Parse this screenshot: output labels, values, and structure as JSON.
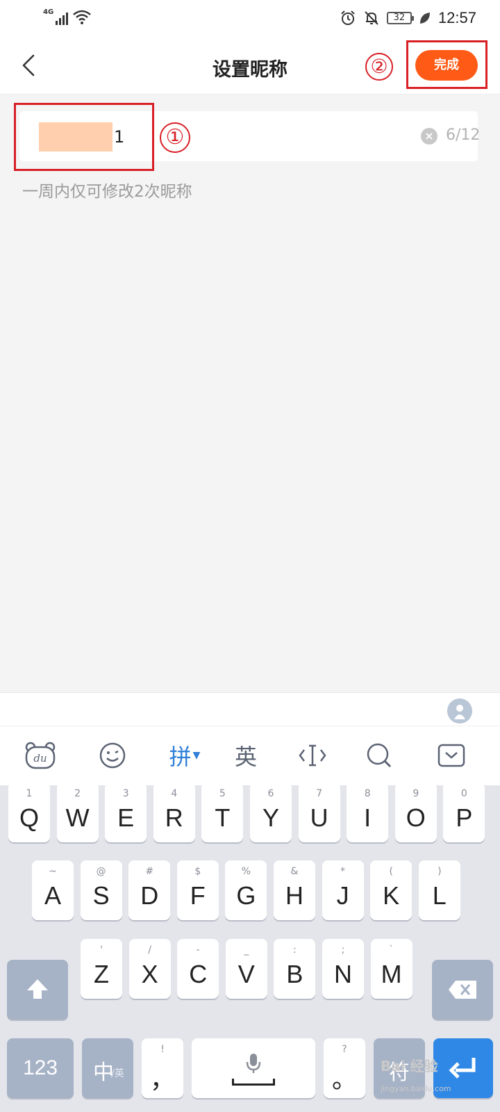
{
  "status": {
    "network": "4G",
    "battery": "32",
    "time": "12:57"
  },
  "header": {
    "title": "设置昵称",
    "done_label": "完成"
  },
  "annotations": {
    "first": "①",
    "second": "②"
  },
  "nickname": {
    "value_suffix": "1",
    "counter": "6/12",
    "hint": "一周内仅可修改2次昵称"
  },
  "keyboard": {
    "toolbar": {
      "pinyin": "拼",
      "english": "英"
    },
    "rows": [
      [
        [
          "Q",
          "1"
        ],
        [
          "W",
          "2"
        ],
        [
          "E",
          "3"
        ],
        [
          "R",
          "4"
        ],
        [
          "T",
          "5"
        ],
        [
          "Y",
          "6"
        ],
        [
          "U",
          "7"
        ],
        [
          "I",
          "8"
        ],
        [
          "O",
          "9"
        ],
        [
          "P",
          "0"
        ]
      ],
      [
        [
          "A",
          "~"
        ],
        [
          "S",
          "@"
        ],
        [
          "D",
          "#"
        ],
        [
          "F",
          "$"
        ],
        [
          "G",
          "%"
        ],
        [
          "H",
          "&"
        ],
        [
          "J",
          "*"
        ],
        [
          "K",
          "("
        ],
        [
          "L",
          ")"
        ]
      ],
      [
        [
          "Z",
          "'"
        ],
        [
          "X",
          "/"
        ],
        [
          "C",
          "-"
        ],
        [
          "V",
          "_"
        ],
        [
          "B",
          ":"
        ],
        [
          "N",
          ";"
        ],
        [
          "M",
          "`"
        ]
      ]
    ],
    "num_key": "123",
    "zh_key_main": "中",
    "zh_key_sub": "/英",
    "comma": "，",
    "comma_sub": "!",
    "period": "。",
    "period_sub": "?",
    "symbol_key": "符"
  },
  "watermark": {
    "main": "Bai 经验",
    "sub": "jingyan.baidu.com"
  }
}
